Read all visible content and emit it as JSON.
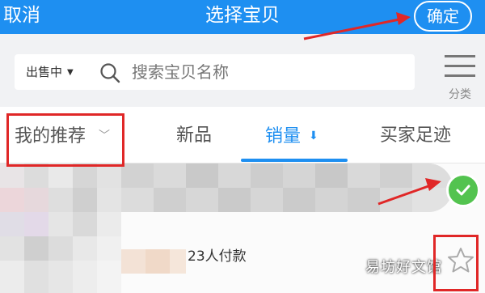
{
  "header": {
    "cancel_label": "取消",
    "title": "选择宝贝",
    "confirm_label": "确定"
  },
  "search": {
    "filter_label": "出售中",
    "placeholder": "搜索宝贝名称"
  },
  "category": {
    "label": "分类",
    "icon": "list-icon"
  },
  "tabs": [
    {
      "label": "我的推荐"
    },
    {
      "label": "新品"
    },
    {
      "label": "销量"
    },
    {
      "label": "买家足迹"
    }
  ],
  "product": {
    "sales_text": "23人付款",
    "selected": true
  },
  "watermark": "易坊好文馆",
  "colors": {
    "accent": "#1e8ff1",
    "check": "#53c34f",
    "annotation": "#e02727"
  }
}
